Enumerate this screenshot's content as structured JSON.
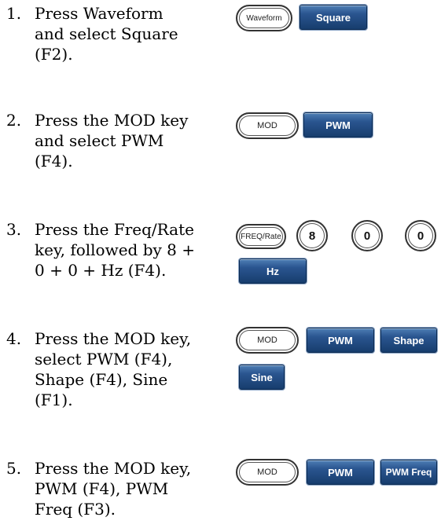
{
  "steps": [
    {
      "number": "1.",
      "lines": [
        "Press Waveform",
        "and select Square",
        "(F2)."
      ],
      "keys": {
        "hw1": "Waveform",
        "soft1": "Square"
      }
    },
    {
      "number": "2.",
      "lines": [
        "Press the MOD key",
        "and select PWM",
        "(F4)."
      ],
      "keys": {
        "hw1": "MOD",
        "soft1": "PWM"
      }
    },
    {
      "number": "3.",
      "lines": [
        "Press the Freq/Rate",
        "key, followed by 8 +",
        "0 + 0 + Hz (F4)."
      ],
      "keys": {
        "hw1": "FREQ/Rate",
        "num1": "8",
        "num2": "0",
        "num3": "0",
        "soft1": "Hz"
      }
    },
    {
      "number": "4.",
      "lines": [
        "Press the MOD key,",
        "select PWM (F4),",
        "Shape (F4), Sine",
        "(F1)."
      ],
      "keys": {
        "hw1": "MOD",
        "soft1": "PWM",
        "soft2": "Shape",
        "soft3": "Sine"
      }
    },
    {
      "number": "5.",
      "lines": [
        "Press the MOD key,",
        "PWM (F4), PWM",
        "Freq (F3)."
      ],
      "keys": {
        "hw1": "MOD",
        "soft1": "PWM",
        "soft2": "PWM Freq"
      }
    }
  ]
}
